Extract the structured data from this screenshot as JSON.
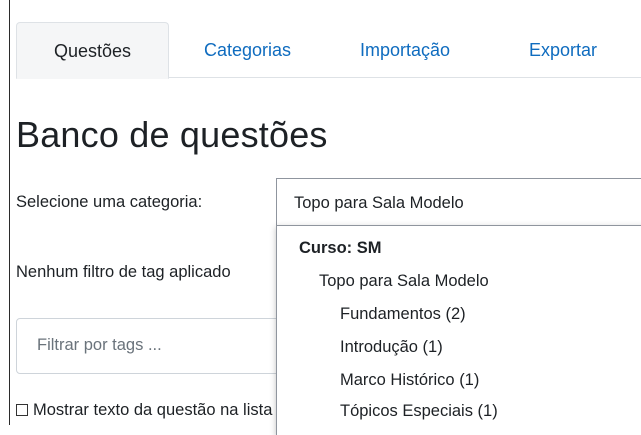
{
  "tabs": [
    {
      "label": "Questões",
      "active": true
    },
    {
      "label": "Categorias",
      "active": false
    },
    {
      "label": "Importação",
      "active": false
    },
    {
      "label": "Exportar",
      "active": false
    }
  ],
  "page_title": "Banco de questões",
  "category": {
    "label": "Selecione uma categoria:",
    "selected": "Topo para Sala Modelo"
  },
  "tag_filter_text": "Nenhum filtro de tag aplicado",
  "filter": {
    "placeholder": "Filtrar por tags ..."
  },
  "show_text": {
    "label": "Mostrar texto da questão na lista de questões",
    "checked": false
  },
  "dropdown": {
    "group": "Curso: SM",
    "items": [
      "Topo para Sala Modelo",
      "Fundamentos (2)",
      "Introdução (1)",
      "Marco Histórico (1)",
      "Tópicos Especiais (1)"
    ]
  },
  "colors": {
    "link": "#0f6cbf",
    "text": "#1d2125",
    "border": "#8f959e"
  }
}
